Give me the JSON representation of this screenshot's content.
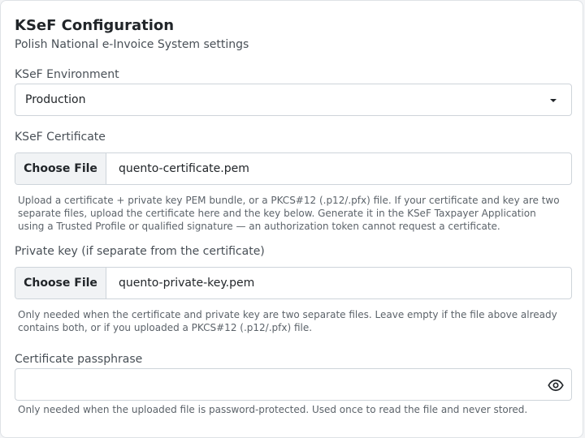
{
  "header": {
    "title": "KSeF Configuration",
    "subtitle": "Polish National e-Invoice System settings"
  },
  "environment": {
    "label": "KSeF Environment",
    "selected": "Production"
  },
  "certificate": {
    "label": "KSeF Certificate",
    "button_label": "Choose File",
    "file_name": "quento-certificate.pem",
    "help": "Upload a certificate + private key PEM bundle, or a PKCS#12 (.p12/.pfx) file. If your certificate and key are two separate files, upload the certificate here and the key below. Generate it in the KSeF Taxpayer Application using a Trusted Profile or qualified signature — an authorization token cannot request a certificate."
  },
  "private_key": {
    "label": "Private key (if separate from the certificate)",
    "button_label": "Choose File",
    "file_name": "quento-private-key.pem",
    "help": "Only needed when the certificate and private key are two separate files. Leave empty if the file above already contains both, or if you uploaded a PKCS#12 (.p12/.pfx) file."
  },
  "passphrase": {
    "label": "Certificate passphrase",
    "value": "",
    "help": "Only needed when the uploaded file is password-protected. Used once to read the file and never stored.",
    "toggle_icon": "eye-icon"
  }
}
